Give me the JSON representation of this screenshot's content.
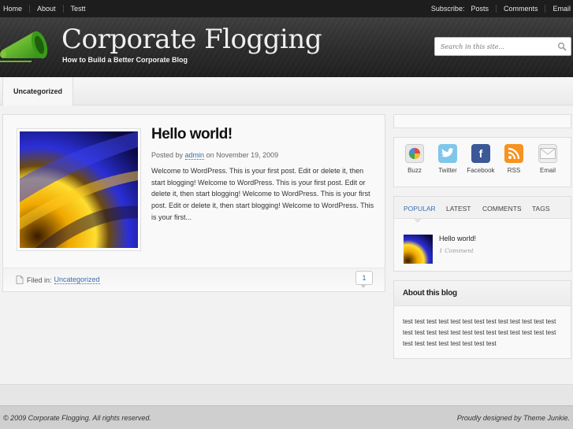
{
  "topbar": {
    "left_links": [
      "Home",
      "About",
      "Testt"
    ],
    "subscribe_label": "Subscribe:",
    "right_links": [
      "Posts",
      "Comments",
      "Email"
    ]
  },
  "header": {
    "title": "Corporate Flogging",
    "tagline": "How to Build a Better Corporate Blog",
    "search_placeholder": "Search in this site..."
  },
  "nav": {
    "items": [
      "Uncategorized"
    ]
  },
  "post": {
    "title": "Hello world!",
    "meta_prefix": "Posted by",
    "author": "admin",
    "meta_on": "on",
    "date": "November 19, 2009",
    "excerpt": "Welcome to WordPress. This is your first post. Edit or delete it, then start blogging! Welcome to WordPress. This is your first post. Edit or delete it, then start blogging! Welcome to WordPress. This is your first post. Edit or delete it, then start blogging! Welcome to WordPress. This is your first...",
    "filed_label": "Filed in:",
    "category": "Uncategorized",
    "comment_count": "1"
  },
  "social": [
    {
      "label": "Buzz",
      "icon": "google-buzz-icon",
      "color": "#e8e8e8"
    },
    {
      "label": "Twitter",
      "icon": "twitter-bird-icon",
      "color": "#7fc6ea"
    },
    {
      "label": "Facebook",
      "icon": "facebook-icon",
      "color": "#3b5998"
    },
    {
      "label": "RSS",
      "icon": "rss-icon",
      "color": "#f7931e"
    },
    {
      "label": "Email",
      "icon": "envelope-icon",
      "color": "#eeeeee"
    }
  ],
  "tabs": {
    "labels": [
      "POPULAR",
      "LATEST",
      "COMMENTS",
      "TAGS"
    ],
    "active": "POPULAR",
    "popular": [
      {
        "title": "Hello world!",
        "comments": "1 Comment"
      }
    ]
  },
  "about": {
    "heading": "About this blog",
    "text": "test test test test test test test test test test test test test test test test test test test test test test test test test test test test test test test test test test"
  },
  "footer": {
    "copyright": "© 2009 Corporate Flogging. All rights reserved.",
    "credit": "Proudly designed by Theme Junkie."
  }
}
